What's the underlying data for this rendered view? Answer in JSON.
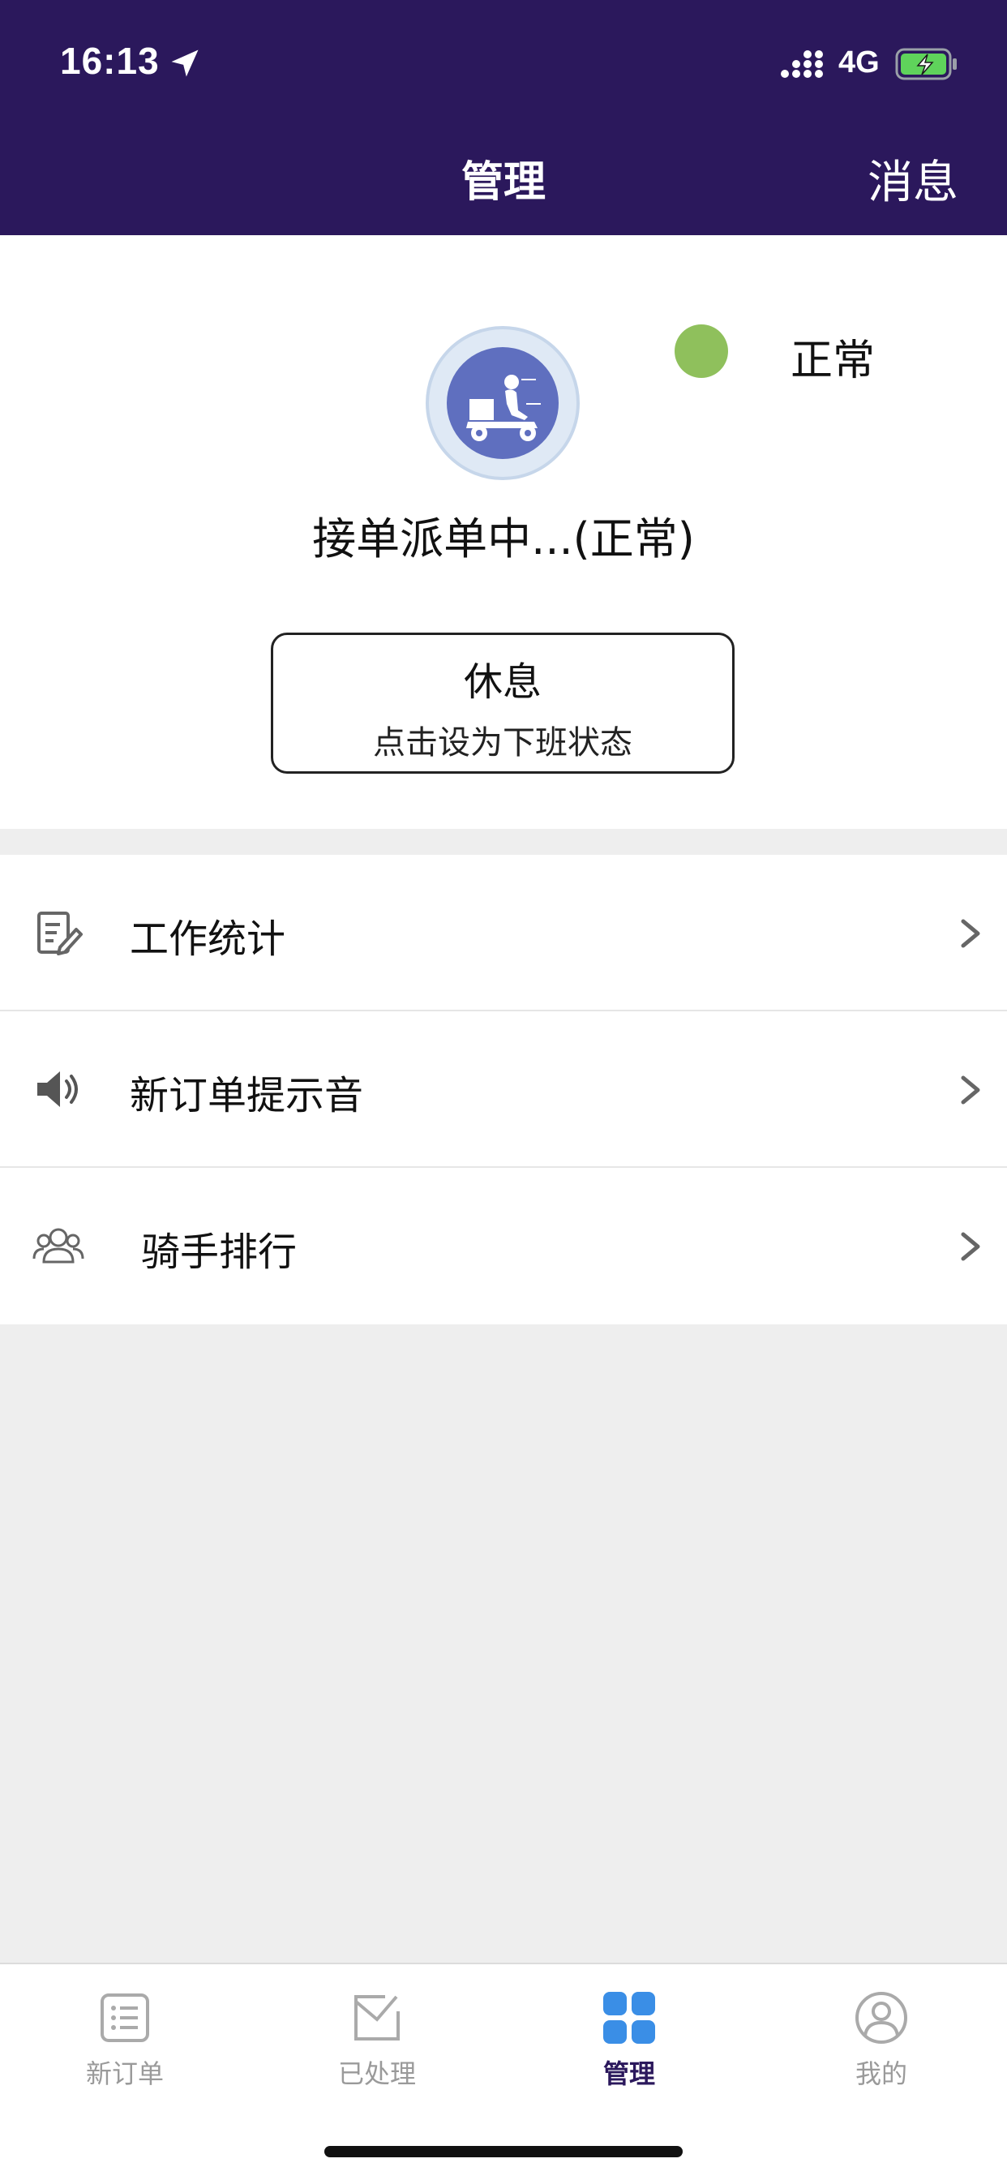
{
  "status_bar": {
    "time": "16:13",
    "network": "4G",
    "icons": [
      "location-arrow-icon",
      "signal-icon",
      "battery-charging-icon"
    ]
  },
  "nav": {
    "title": "管理",
    "right_action": "消息"
  },
  "profile": {
    "status_label": "正常",
    "status_color": "#8fc05c",
    "dispatch_status": "接单派单中...(正常)",
    "rest_button": {
      "title": "休息",
      "subtitle": "点击设为下班状态"
    }
  },
  "menu": {
    "items": [
      {
        "label": "工作统计",
        "icon": "edit-note-icon"
      },
      {
        "label": "新订单提示音",
        "icon": "speaker-icon"
      },
      {
        "label": "骑手排行",
        "icon": "users-icon"
      }
    ]
  },
  "tabs": [
    {
      "label": "新订单",
      "icon": "list-icon",
      "active": false
    },
    {
      "label": "已处理",
      "icon": "mail-check-icon",
      "active": false
    },
    {
      "label": "管理",
      "icon": "grid-icon",
      "active": true
    },
    {
      "label": "我的",
      "icon": "user-circle-icon",
      "active": false
    }
  ],
  "colors": {
    "header_bg": "#2b185c",
    "accent_blue": "#3a8ee6",
    "page_bg": "#eeeeee"
  }
}
